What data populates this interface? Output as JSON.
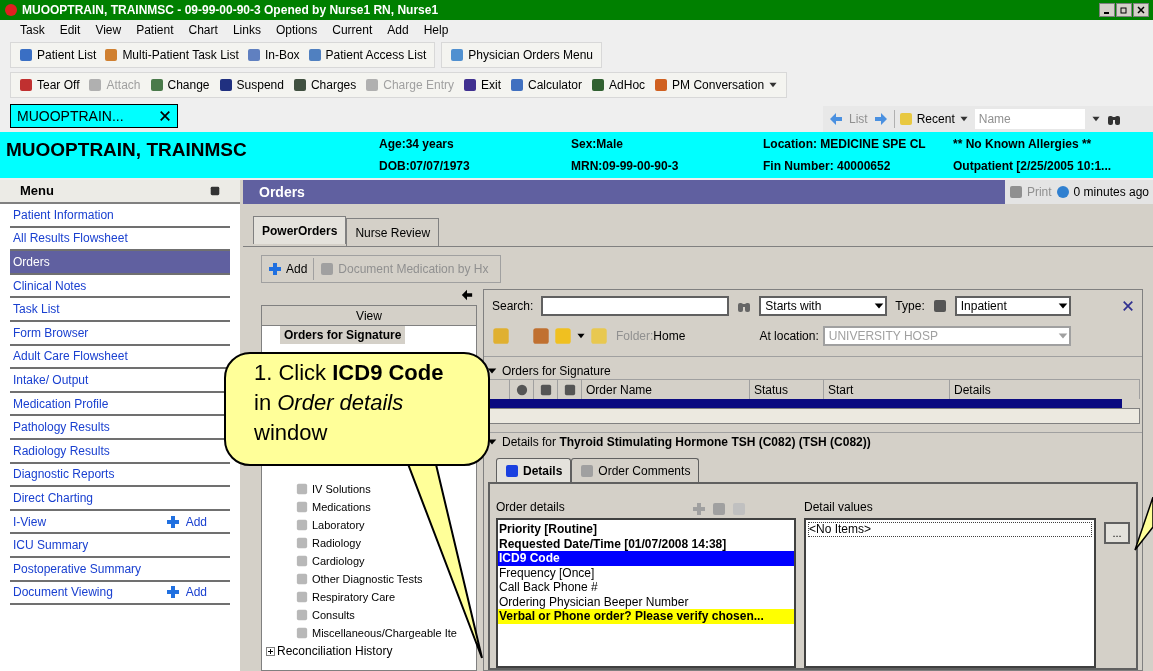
{
  "window": {
    "title": "MUOOPTRAIN, TRAINMSC - 09-99-00-90-3 Opened by Nurse1 RN, Nurse1"
  },
  "menu_bar": [
    "Task",
    "Edit",
    "View",
    "Patient",
    "Chart",
    "Links",
    "Options",
    "Current",
    "Add",
    "Help"
  ],
  "toolbar_1": [
    {
      "label": "Patient List",
      "disabled": false
    },
    {
      "label": "Multi-Patient Task List",
      "disabled": false
    },
    {
      "label": "In-Box",
      "disabled": false
    },
    {
      "label": "Patient Access List",
      "disabled": false
    }
  ],
  "toolbar_1b": [
    {
      "label": "Physician Orders Menu",
      "disabled": false
    }
  ],
  "toolbar_2": [
    {
      "label": "Tear Off",
      "disabled": false
    },
    {
      "label": "Attach",
      "disabled": true
    },
    {
      "label": "Change",
      "disabled": false
    },
    {
      "label": "Suspend",
      "disabled": false
    },
    {
      "label": "Charges",
      "disabled": false
    },
    {
      "label": "Charge Entry",
      "disabled": true
    },
    {
      "label": "Exit",
      "disabled": false
    },
    {
      "label": "Calculator",
      "disabled": false
    },
    {
      "label": "AdHoc",
      "disabled": false
    },
    {
      "label": "PM Conversation",
      "disabled": false
    }
  ],
  "patient_tab": {
    "label": "MUOOPTRAIN..."
  },
  "nav_bar": {
    "list_label": "List",
    "recent_label": "Recent",
    "name_placeholder": "Name"
  },
  "banner": {
    "name": "MUOOPTRAIN, TRAINMSC",
    "fields": [
      "Age:34 years",
      "Sex:Male",
      "Location: MEDICINE SPE CL",
      "** No Known Allergies **",
      "DOB:07/07/1973",
      "MRN:09-99-00-90-3",
      "Fin Number: 40000652",
      "Outpatient [2/25/2005 10:1..."
    ]
  },
  "sidebar": {
    "title": "Menu",
    "items": [
      {
        "label": "Patient Information",
        "selected": false
      },
      {
        "label": "All Results Flowsheet",
        "selected": false
      },
      {
        "label": "Orders",
        "selected": true
      },
      {
        "label": "Clinical Notes",
        "selected": false
      },
      {
        "label": "Task List",
        "selected": false
      },
      {
        "label": "Form Browser",
        "selected": false
      },
      {
        "label": "Adult Care Flowsheet",
        "selected": false
      },
      {
        "label": "Intake/ Output",
        "selected": false
      },
      {
        "label": "Medication Profile",
        "selected": false
      },
      {
        "label": "Pathology Results",
        "selected": false
      },
      {
        "label": "Radiology Results",
        "selected": false
      },
      {
        "label": "Diagnostic Reports",
        "selected": false
      },
      {
        "label": "Direct Charting",
        "selected": false
      },
      {
        "label": "I-View",
        "selected": false,
        "action": "Add"
      },
      {
        "label": "ICU Summary",
        "selected": false
      },
      {
        "label": "Postoperative Summary",
        "selected": false
      },
      {
        "label": "Document Viewing",
        "selected": false,
        "action": "Add"
      }
    ]
  },
  "orders_panel": {
    "title": "Orders",
    "print_label": "Print",
    "updated": "0 minutes ago"
  },
  "tabs": [
    {
      "label": "PowerOrders",
      "selected": true
    },
    {
      "label": "Nurse Review",
      "selected": false
    }
  ],
  "action_bar": [
    {
      "label": "Add",
      "disabled": false
    },
    {
      "label": "Document Medication by Hx",
      "disabled": true
    }
  ],
  "tree": {
    "header": "View",
    "items": [
      {
        "label": "Orders for Signature",
        "kind": "heading"
      },
      {
        "label": "IV Solutions",
        "kind": "category"
      },
      {
        "label": "Medications",
        "kind": "category"
      },
      {
        "label": "Laboratory",
        "kind": "category"
      },
      {
        "label": "Radiology",
        "kind": "category"
      },
      {
        "label": "Cardiology",
        "kind": "category"
      },
      {
        "label": "Other Diagnostic Tests",
        "kind": "category"
      },
      {
        "label": "Respiratory Care",
        "kind": "category"
      },
      {
        "label": "Consults",
        "kind": "category"
      },
      {
        "label": "Miscellaneous/Chargeable Ite",
        "kind": "category"
      },
      {
        "label": "Reconciliation History",
        "kind": "group",
        "expanded": false
      }
    ]
  },
  "search": {
    "label": "Search:",
    "match_type": "Starts with",
    "type_label": "Type:",
    "type_value": "Inpatient",
    "folder_label": "Folder:",
    "folder_value": "Home",
    "location_label": "At location:",
    "location_value": "UNIVERSITY HOSP"
  },
  "orders_for_signature": {
    "title": "Orders for Signature",
    "expanded": true,
    "columns": [
      "Order Name",
      "Status",
      "Start",
      "Details"
    ],
    "rows": [
      {
        "selected": true
      }
    ]
  },
  "details": {
    "prefix": "Details for",
    "order_name": "Thyroid Stimulating Hormone TSH (C082) (TSH (C082))",
    "expanded": true,
    "tabs": [
      {
        "label": "Details",
        "selected": true
      },
      {
        "label": "Order Comments",
        "selected": false
      }
    ],
    "order_details_label": "Order details",
    "rows": [
      {
        "text": "Priority   [Routine]",
        "kind": "required",
        "selected": false
      },
      {
        "text": "Requested Date/Time   [01/07/2008 14:38]",
        "kind": "required",
        "selected": false
      },
      {
        "text": "ICD9 Code",
        "kind": "required",
        "selected": true
      },
      {
        "text": "Frequency   [Once]",
        "kind": "optional",
        "selected": false
      },
      {
        "text": "Call Back Phone #",
        "kind": "optional",
        "selected": false
      },
      {
        "text": "Ordering Physician Beeper Number",
        "kind": "optional",
        "selected": false
      },
      {
        "text": "Verbal or Phone order? Please verify chosen...",
        "kind": "warning",
        "selected": false
      }
    ],
    "detail_values_label": "Detail values",
    "values": [
      "<No Items>"
    ],
    "browse_label": "..."
  },
  "callout": {
    "text": "1.  Click **ICD9 Code** in *Order details* window"
  }
}
